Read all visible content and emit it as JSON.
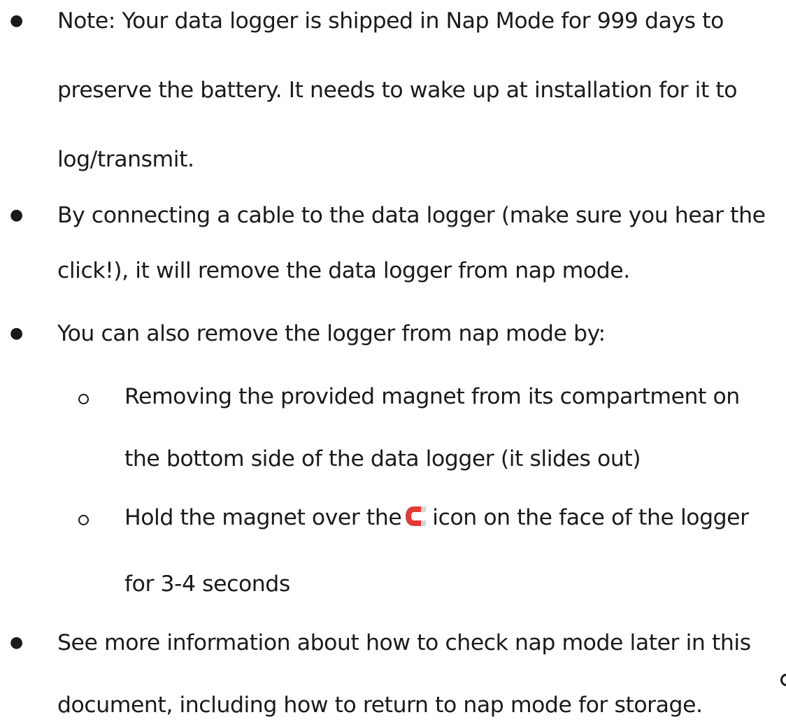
{
  "bullets": [
    {
      "lines": [
        "Note: Your data logger is shipped in Nap Mode for 999 days to",
        "preserve the battery. It needs to  wake up at installation for it to",
        "log/transmit."
      ]
    },
    {
      "lines": [
        "By connecting a cable to the data logger (make sure you hear the",
        "click!), it will remove the data logger from nap mode."
      ]
    },
    {
      "lines": [
        "You can also remove the logger from nap mode by:"
      ],
      "sub_bullets": [
        {
          "lines": [
            "Removing the provided magnet from its compartment on",
            "the bottom side of the data logger (it slides out)"
          ]
        },
        {
          "line1_before_icon": "Hold the magnet over the",
          "icon": "magnet-icon",
          "line1_after_icon": "icon on the face of the logger",
          "line2": "for 3-4 seconds"
        }
      ]
    },
    {
      "lines": [
        "See more information about how to check nap mode later in this",
        "document, including how to return to nap mode for storage."
      ]
    }
  ],
  "bullet_glyph": "●",
  "colors": {
    "text": "#1a1a1a",
    "magnet_red": "#e53935",
    "magnet_tip": "#cfd8dc"
  }
}
